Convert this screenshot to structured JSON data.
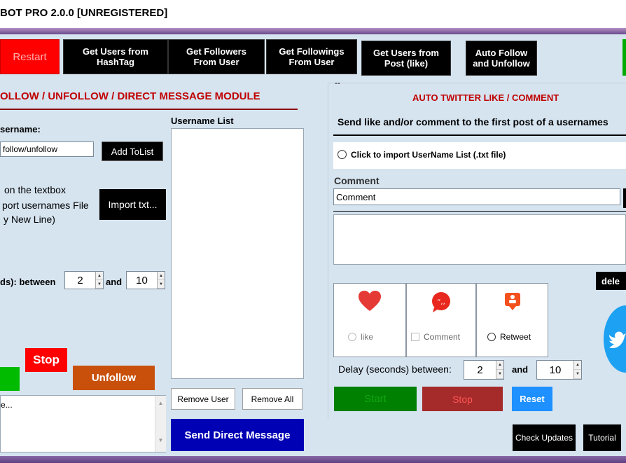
{
  "window": {
    "title": "BOT PRO 2.0.0 [UNREGISTERED]"
  },
  "toolbar": {
    "restart": "Restart",
    "get_users_hashtag": "Get Users from\nHashTag",
    "get_followers": "Get Followers\nFrom User",
    "get_followings": "Get Followings\nFrom User",
    "get_users_post": "Get Users from\nPost (like)",
    "auto_follow": "Auto Follow\nand Unfollow"
  },
  "left": {
    "module_title": "OLLOW / UNFOLLOW / DIRECT MESSAGE MODULE",
    "username_label": "sername:",
    "username_placeholder": "follow/unfollow",
    "add_to_list": "Add ToList",
    "import_hint_1": "on the textbox",
    "import_hint_2": "port usernames File",
    "import_hint_3": "y New Line)",
    "import_txt": "Import txt...",
    "delay_label": "ds): between",
    "delay_min": "2",
    "delay_and": "and",
    "delay_max": "10",
    "stop": "Stop",
    "unfollow": "Unfollow",
    "log_text": "e...",
    "username_list_label": "Username List",
    "remove_user": "Remove User",
    "remove_all": "Remove All",
    "send_dm": "Send Direct Message"
  },
  "right": {
    "dash": "--",
    "title": "AUTO TWITTER LIKE / COMMENT",
    "subtitle": "Send like and/or comment to the first post of a usernames",
    "import_radio": "Click to import UserName List (.txt file)",
    "comment_label": "Comment",
    "comment_value": "Comment",
    "del_btn": "dele",
    "like": "like",
    "comment_opt": "Comment",
    "retweet": "Retweet",
    "delay_label": "Delay (seconds) between:",
    "delay_min": "2",
    "delay_and": "and",
    "delay_max": "10",
    "start": "Start",
    "stop": "Stop",
    "reset": "Reset",
    "check_updates": "Check Updates",
    "tutorial": "Tutorial"
  },
  "colors": {
    "restart_bg": "#ff0000",
    "red_title": "#c00000",
    "green": "#00aa00",
    "unfollow_bg": "#c8500a",
    "dm_bg": "#0000b4",
    "start_bg": "#008000",
    "stop_bg": "#a52a2a",
    "reset_bg": "#1e90ff",
    "twitter_blue": "#1da1f2"
  }
}
